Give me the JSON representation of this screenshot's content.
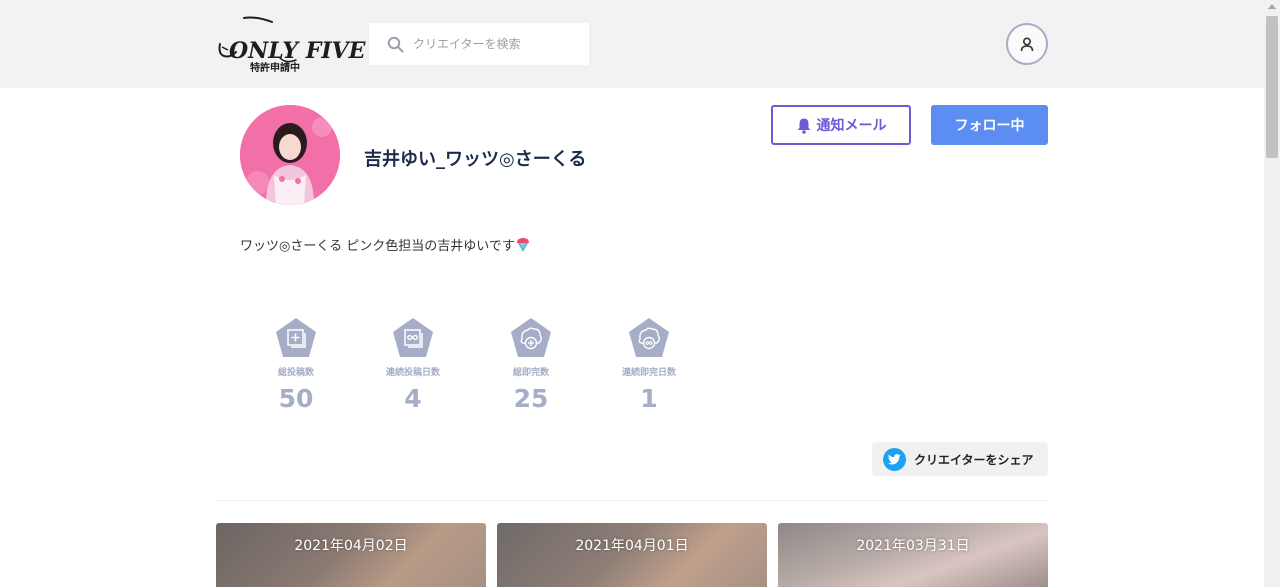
{
  "header": {
    "logo_text": "ONLY FIVE",
    "logo_sub": "特許申請中",
    "search_placeholder": "クリエイターを検索"
  },
  "profile": {
    "name": "吉井ゆい_ワッツ◎さーくる",
    "bio": "ワッツ◎さーくる ピンク色担当の吉井ゆいです",
    "notify_label": "通知メール",
    "follow_label": "フォロー中"
  },
  "stats": [
    {
      "label": "総投稿数",
      "value": "50",
      "icon": "post-add-icon"
    },
    {
      "label": "連続投稿日数",
      "value": "4",
      "icon": "infinity-post-icon"
    },
    {
      "label": "総即完数",
      "value": "25",
      "icon": "sold-out-icon"
    },
    {
      "label": "連続即完日数",
      "value": "1",
      "icon": "infinity-sold-out-icon"
    }
  ],
  "share": {
    "label": "クリエイターをシェア"
  },
  "posts": [
    {
      "date": "2021年04月02日"
    },
    {
      "date": "2021年04月01日"
    },
    {
      "date": "2021年03月31日"
    }
  ],
  "colors": {
    "accent_purple": "#6c5ad6",
    "follow_blue": "#5b8df2",
    "stat_gray": "#a6adc6",
    "twitter_blue": "#1da1f2"
  }
}
